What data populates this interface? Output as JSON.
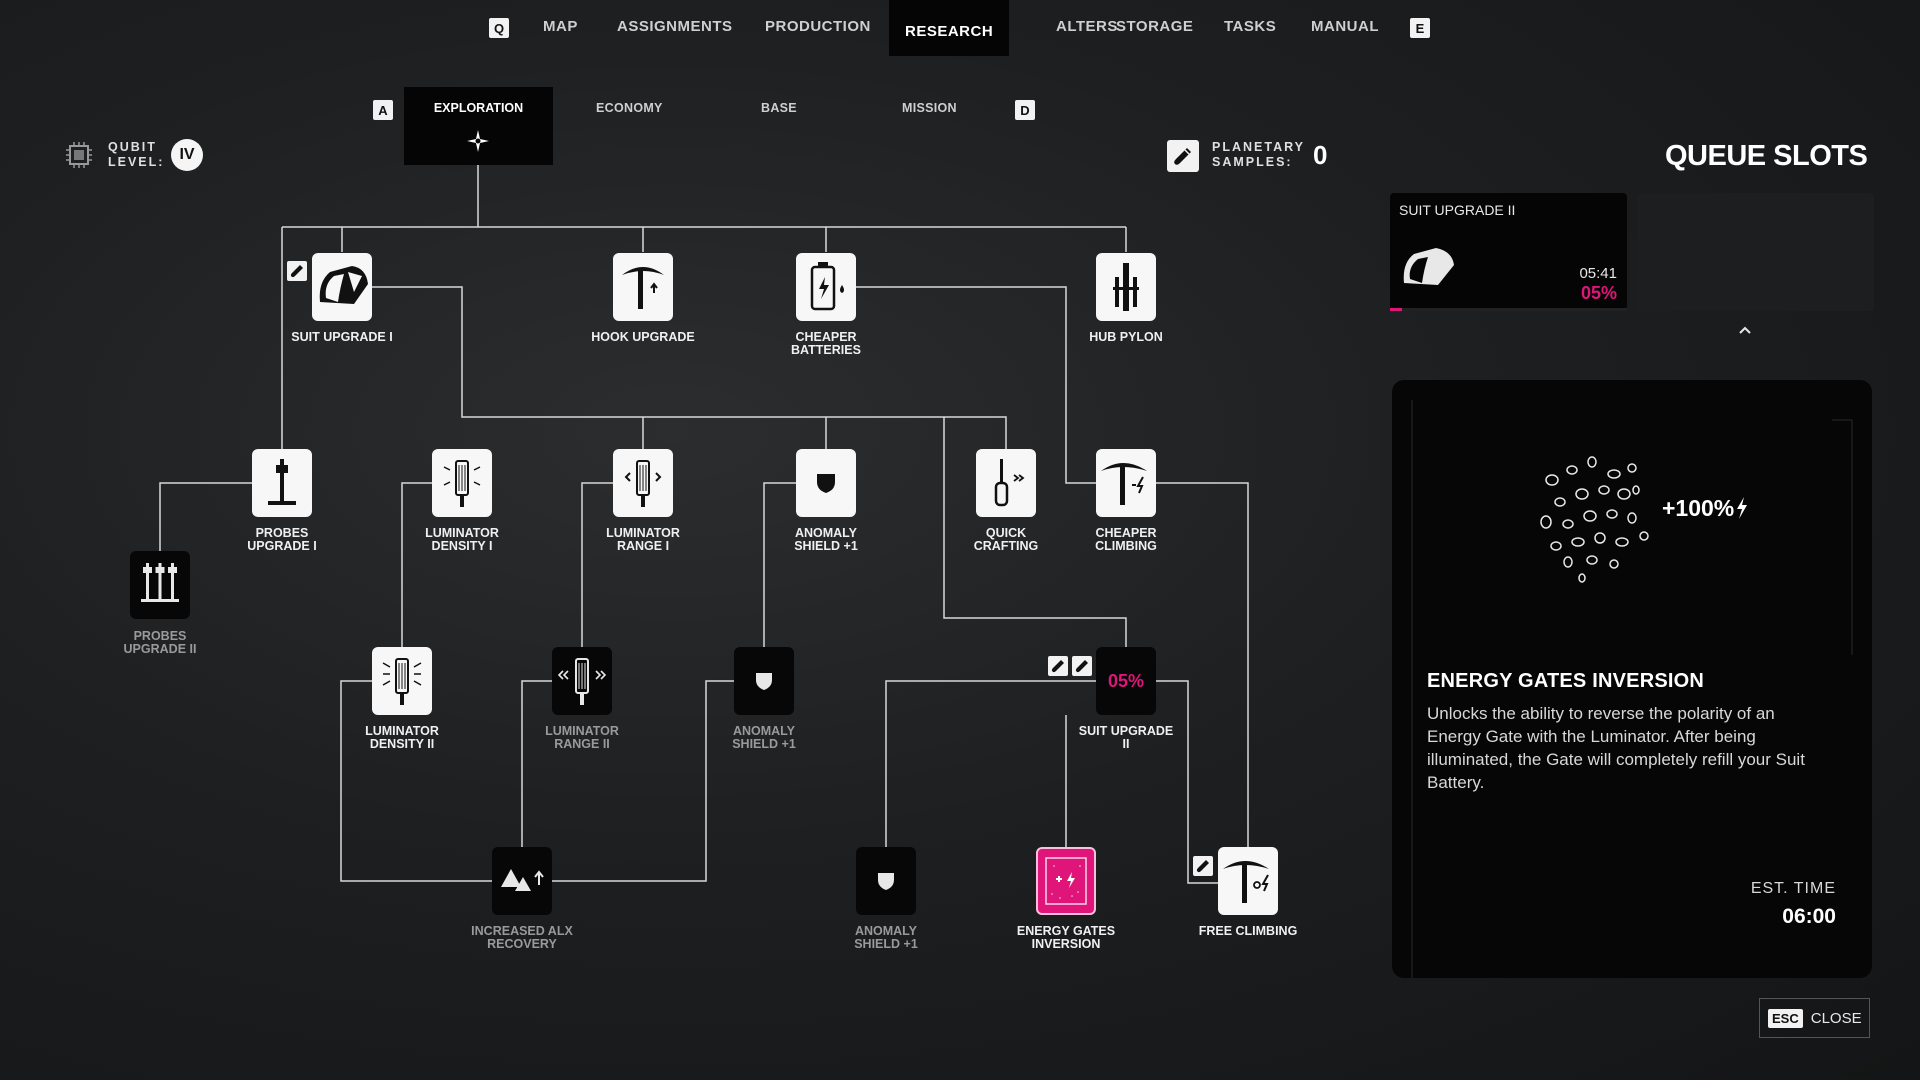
{
  "nav": {
    "key_left": "Q",
    "key_right": "E",
    "items": [
      "MAP",
      "ASSIGNMENTS",
      "PRODUCTION",
      "RESEARCH",
      "ALTERS",
      "STORAGE",
      "TASKS",
      "MANUAL"
    ],
    "active": "RESEARCH"
  },
  "subtabs": {
    "key_left": "A",
    "key_right": "D",
    "items": [
      "EXPLORATION",
      "ECONOMY",
      "BASE",
      "MISSION"
    ],
    "active": "EXPLORATION"
  },
  "qubit": {
    "label_line1": "QUBIT",
    "label_line2": "LEVEL:",
    "value": "IV"
  },
  "samples": {
    "label_line1": "PLANETARY",
    "label_line2": "SAMPLES:",
    "value": "0"
  },
  "tree": {
    "suit_upgrade_1": "SUIT UPGRADE I",
    "hook_upgrade": "HOOK UPGRADE",
    "cheaper_batteries_1": "CHEAPER",
    "cheaper_batteries_2": "BATTERIES",
    "hub_pylon": "HUB PYLON",
    "probes_upgrade_1_a": "PROBES",
    "probes_upgrade_1_b": "UPGRADE I",
    "luminator_density_1_a": "LUMINATOR",
    "luminator_density_1_b": "DENSITY I",
    "luminator_range_1_a": "LUMINATOR",
    "luminator_range_1_b": "RANGE I",
    "anomaly_shield_a_1": "ANOMALY",
    "anomaly_shield_a_2": "SHIELD +1",
    "quick_crafting_1": "QUICK",
    "quick_crafting_2": "CRAFTING",
    "cheaper_climbing_1": "CHEAPER",
    "cheaper_climbing_2": "CLIMBING",
    "probes_upgrade_2_a": "PROBES",
    "probes_upgrade_2_b": "UPGRADE II",
    "luminator_density_2_a": "LUMINATOR",
    "luminator_density_2_b": "DENSITY II",
    "luminator_range_2_a": "LUMINATOR",
    "luminator_range_2_b": "RANGE II",
    "anomaly_shield_b_1": "ANOMALY",
    "anomaly_shield_b_2": "SHIELD +1",
    "suit_upgrade_2_a": "SUIT UPGRADE",
    "suit_upgrade_2_b": "II",
    "suit_upgrade_2_progress": "05%",
    "increased_alx_1": "INCREASED ALX",
    "increased_alx_2": "RECOVERY",
    "anomaly_shield_c_1": "ANOMALY",
    "anomaly_shield_c_2": "SHIELD +1",
    "energy_gates_1": "ENERGY GATES",
    "energy_gates_2": "INVERSION",
    "free_climbing": "FREE CLIMBING"
  },
  "queue": {
    "title": "QUEUE SLOTS",
    "slot1": {
      "name": "SUIT UPGRADE II",
      "time": "05:41",
      "progress_text": "05%",
      "progress": 0.05
    }
  },
  "info": {
    "title": "ENERGY GATES INVERSION",
    "bonus": "+100%",
    "description": "Unlocks the ability to reverse the polarity of an Energy Gate with the Luminator. After being illuminated, the Gate will completely refill your Suit Battery.",
    "est_label": "EST. TIME",
    "est_value": "06:00"
  },
  "close": {
    "key": "ESC",
    "label": "CLOSE"
  },
  "colors": {
    "accent": "#e0157a",
    "node_white": "#f7f7f7",
    "node_black": "#070707"
  }
}
